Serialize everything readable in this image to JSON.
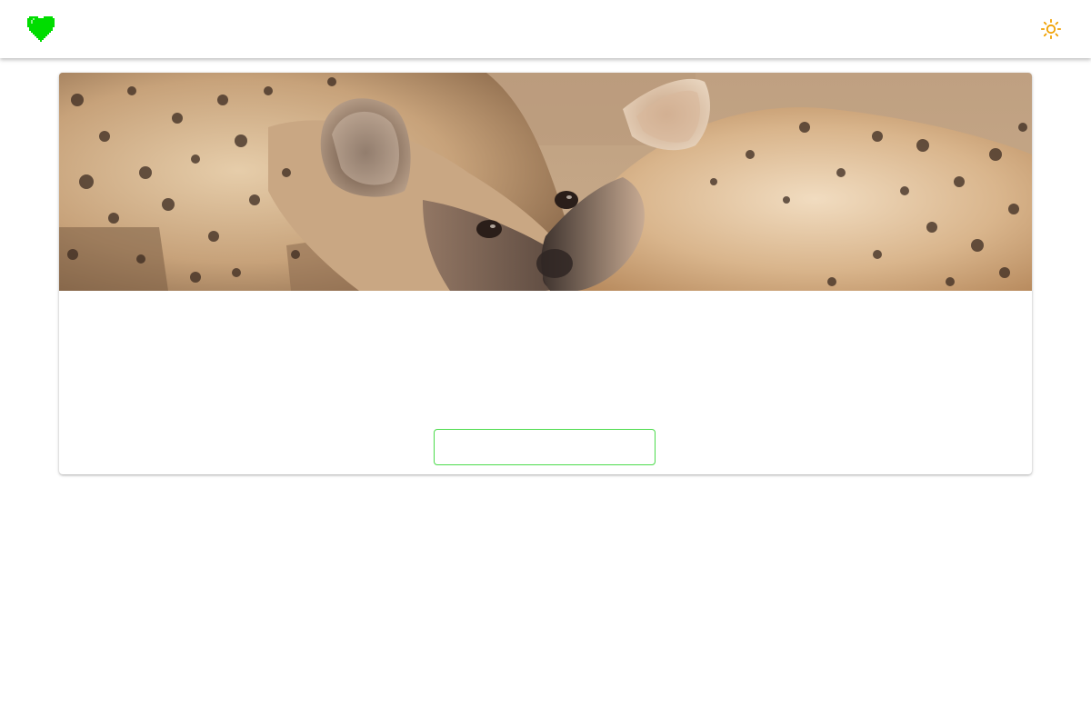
{
  "app_bar": {
    "logo_icon": "pixel-heart-icon",
    "theme_toggle_icon": "sun-icon"
  },
  "card": {
    "image": "two-hyenas-photo",
    "action_button_label": ""
  },
  "colors": {
    "logo": "#00dd00",
    "theme_icon": "#f0a000",
    "button_border": "#4cdb4c"
  }
}
